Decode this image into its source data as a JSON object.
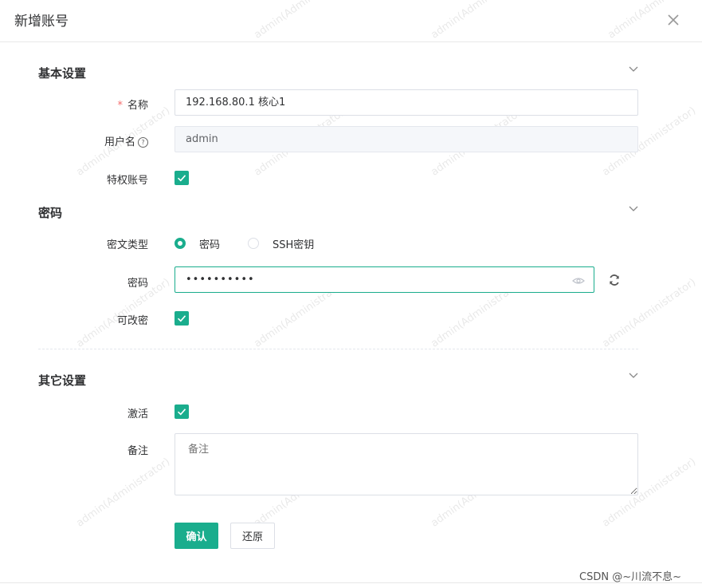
{
  "dialog": {
    "title": "新增账号"
  },
  "basic": {
    "title": "基本设置",
    "name_label": "名称",
    "name_value": "192.168.80.1 核心1",
    "username_label": "用户名",
    "username_value": "admin",
    "privileged_label": "特权账号",
    "privileged_checked": true
  },
  "password": {
    "title": "密码",
    "type_label": "密文类型",
    "type_options": [
      "密码",
      "SSH密钥"
    ],
    "type_selected": "密码",
    "password_label": "密码",
    "password_value": "••••••••••",
    "changeable_label": "可改密",
    "changeable_checked": true
  },
  "other": {
    "title": "其它设置",
    "active_label": "激活",
    "active_checked": true,
    "remark_label": "备注",
    "remark_placeholder": "备注"
  },
  "actions": {
    "confirm": "确认",
    "reset": "还原"
  },
  "watermark": "admin(Administrator)",
  "credit": "CSDN @~川流不息~",
  "colors": {
    "accent": "#1aad8d",
    "required": "#f56c6c"
  },
  "icons": [
    "close-icon",
    "chevron-down-icon",
    "question-circle-icon",
    "checkmark-icon",
    "eye-icon",
    "refresh-icon"
  ]
}
